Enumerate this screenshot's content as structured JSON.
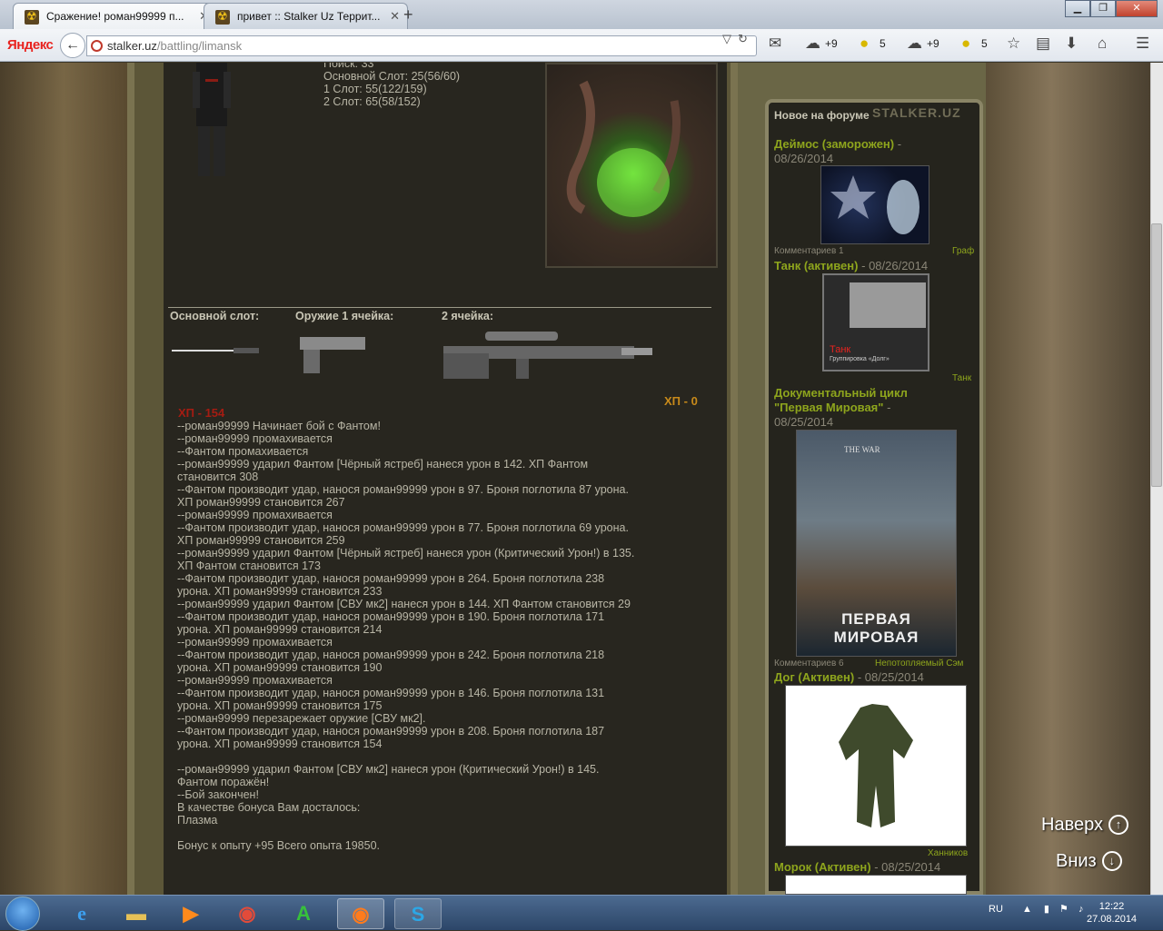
{
  "browser": {
    "tabs": [
      {
        "title": "Сражение! роман99999 п..."
      },
      {
        "title": "привет :: Stalker Uz Террит..."
      }
    ],
    "logo": "Яндекс",
    "url_domain": "stalker.uz",
    "url_path": "/battling/limansk",
    "weather": [
      {
        "icon": "cloud-rain-icon",
        "value": "+9"
      },
      {
        "icon": "traffic-icon",
        "value": "5"
      },
      {
        "icon": "cloud-rain-icon",
        "value": "+9"
      },
      {
        "icon": "traffic-icon",
        "value": "5"
      }
    ]
  },
  "player": {
    "stats": [
      "Поиск: 33",
      "Основной Слот: 25(56/60)",
      "1 Слот: 55(122/159)",
      "2 Слот: 65(58/152)"
    ]
  },
  "slots": {
    "main": "Основной слот:",
    "weapon1": "Оружие 1 ячейка:",
    "weapon2": "2 ячейка:"
  },
  "battle": {
    "hp_enemy": "ХП - 0",
    "hp_player": "ХП - 154",
    "log": [
      "--роман99999 Начинает бой с Фантом!",
      "--роман99999 промахивается",
      "--Фантом промахивается",
      "--роман99999 ударил Фантом [Чёрный ястреб] нанеся урон в 142. ХП Фантом",
      "становится 308",
      "--Фантом производит удар, нанося роман99999 урон в 97. Броня поглотила 87 урона.",
      "ХП роман99999 становится 267",
      "--роман99999 промахивается",
      "--Фантом производит удар, нанося роман99999 урон в 77. Броня поглотила 69 урона.",
      "ХП роман99999 становится 259",
      "--роман99999 ударил Фантом [Чёрный ястреб] нанеся урон (Критический Урон!) в 135.",
      "ХП Фантом становится 173",
      "--Фантом производит удар, нанося роман99999 урон в 264. Броня поглотила 238",
      "урона. ХП роман99999 становится 233",
      "--роман99999 ударил Фантом [СВУ мк2] нанеся урон в 144. ХП Фантом становится 29",
      "--Фантом производит удар, нанося роман99999 урон в 190. Броня поглотила 171",
      "урона. ХП роман99999 становится 214",
      "--роман99999 промахивается",
      "--Фантом производит удар, нанося роман99999 урон в 242. Броня поглотила 218",
      "урона. ХП роман99999 становится 190",
      "--роман99999 промахивается",
      "--Фантом производит удар, нанося роман99999 урон в 146. Броня поглотила 131",
      "урона. ХП роман99999 становится 175",
      "--роман99999 перезарежает оружие [СВУ мк2].",
      "--Фантом производит удар, нанося роман99999 урон в 208. Броня поглотила 187",
      "урона. ХП роман99999 становится 154",
      "",
      "--роман99999 ударил Фантом [СВУ мк2] нанеся урон (Критический Урон!) в 145.",
      "Фантом поражён!",
      "--Бой закончен!",
      "В качестве бонуса Вам досталось:",
      "Плазма",
      "",
      "Бонус к опыту +95 Всего опыта 19850."
    ]
  },
  "sidebar": {
    "title": "Новое на форуме",
    "logo": "STALKER.UZ",
    "posts": [
      {
        "title": "Деймос (заморожен)",
        "date": "08/26/2014",
        "comments": "Комментариев 1",
        "author": "Граф"
      },
      {
        "title": "Танк (активен)",
        "date": "08/26/2014",
        "comments": "",
        "author": "Танк",
        "badge_name": "Танк",
        "badge_group": "Группировка «Долг»"
      },
      {
        "title": "Документальный цикл",
        "title2": "\"Первая Мировая\"",
        "date": "08/25/2014",
        "comments": "Комментариев 6",
        "author": "Непотопляемый Сэм",
        "poster_text": "ПЕРВАЯ МИРОВАЯ",
        "poster_top": "THE WAR"
      },
      {
        "title": "Дог (Активен)",
        "date": "08/25/2014",
        "comments": "",
        "author": "Ханников"
      },
      {
        "title": "Морок (Активен)",
        "date": "08/25/2014"
      }
    ]
  },
  "floating": {
    "up": "Наверх",
    "down": "Вниз"
  },
  "taskbar": {
    "lang": "RU",
    "time": "12:22",
    "date": "27.08.2014"
  }
}
